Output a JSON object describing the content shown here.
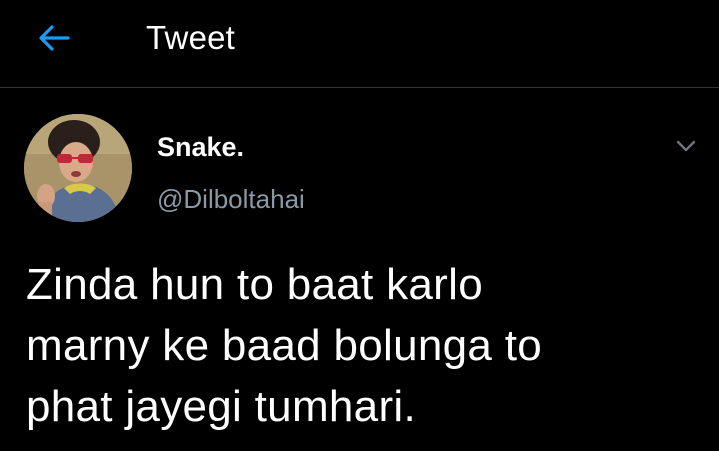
{
  "header": {
    "back_icon": "arrow-left-icon",
    "title": "Tweet"
  },
  "tweet": {
    "author": {
      "display_name": "Snake.",
      "handle": "@Dilboltahai",
      "avatar": "profile-photo"
    },
    "more_icon": "chevron-down-icon",
    "text_lines": [
      "Zinda hun to baat karlo",
      "marny ke baad bolunga to",
      "phat jayegi tumhari."
    ]
  },
  "colors": {
    "background": "#000000",
    "accent": "#1d9bf0",
    "text_primary": "#ffffff",
    "text_secondary": "#8b98a5",
    "divider": "#2f3336"
  }
}
